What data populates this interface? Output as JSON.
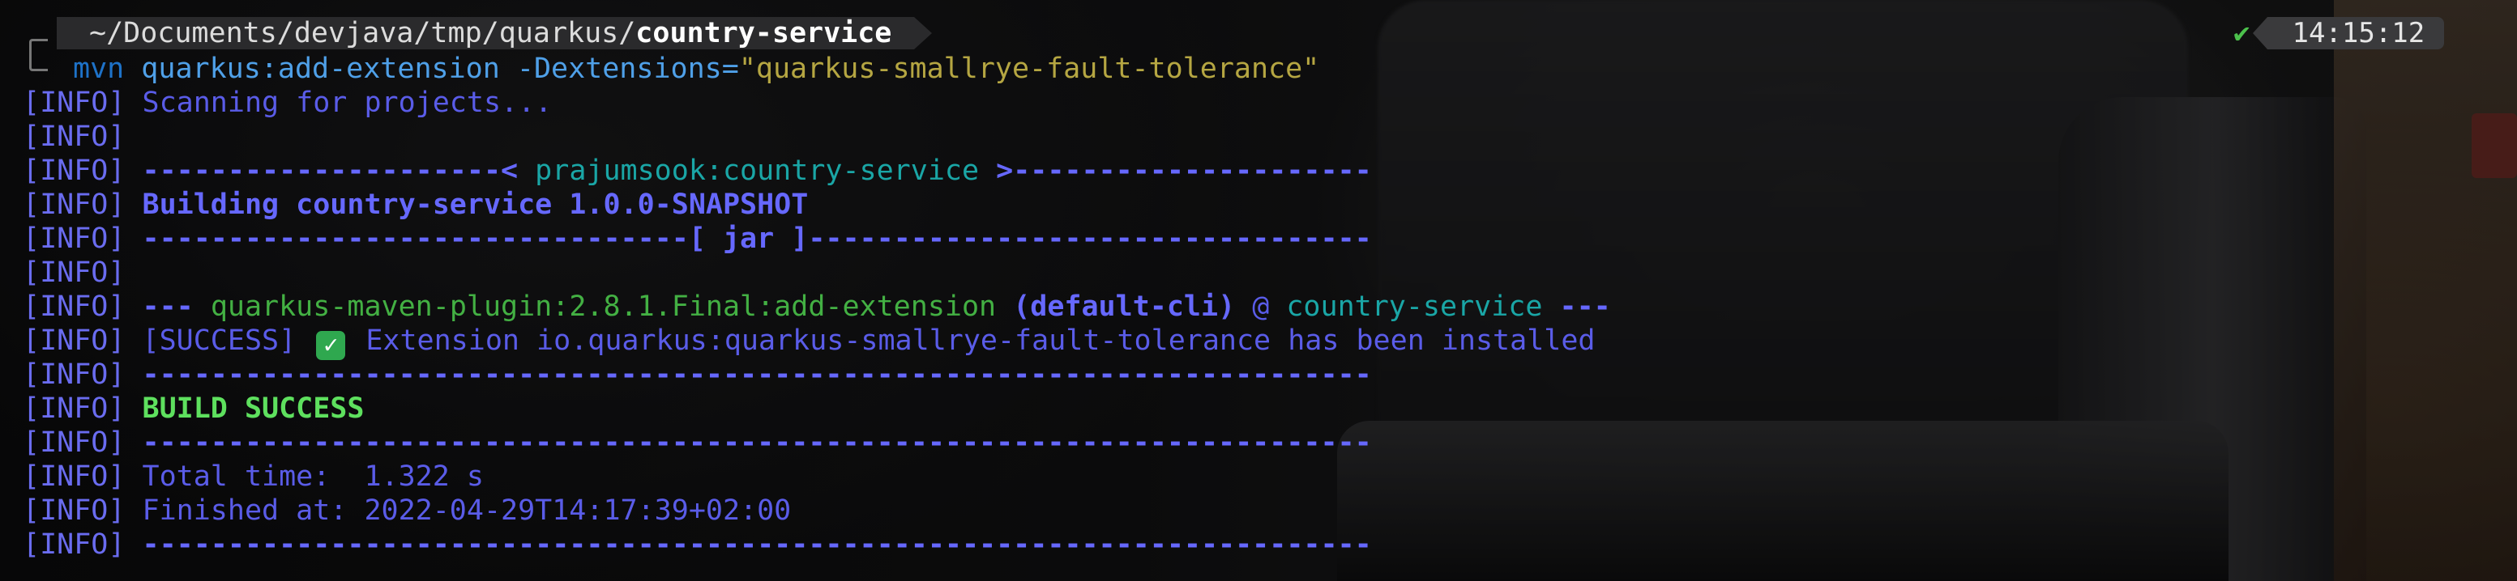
{
  "prompt": {
    "path_prefix": "~/Documents/devjava/tmp/quarkus/",
    "path_current": "country-service",
    "status_icon": "✔",
    "time": "14:15:12"
  },
  "command": {
    "program": "mvn",
    "args": "quarkus:add-extension -Dextensions=",
    "string_arg": "\"quarkus-smallrye-fault-tolerance\""
  },
  "output": {
    "tag": "[INFO]",
    "scanning": "Scanning for projects...",
    "artifact_rule_left": "---------------------< ",
    "artifact_id": "prajumsook:country-service",
    "artifact_rule_right": " >---------------------",
    "building": "Building country-service 1.0.0-SNAPSHOT",
    "jar_rule_left": "--------------------------------[ ",
    "jar_label": "jar",
    "jar_rule_right": " ]---------------------------------",
    "plugin_prefix": "--- ",
    "plugin": "quarkus-maven-plugin:2.8.1.Final:add-extension",
    "execution": "(default-cli)",
    "at": " @ ",
    "module": "country-service",
    "plugin_suffix": " ---",
    "success_tag": "[SUCCESS]",
    "success_emoji": "✓",
    "success_msg": " Extension io.quarkus:quarkus-smallrye-fault-tolerance has been installed",
    "separator": "------------------------------------------------------------------------",
    "build_success": "BUILD SUCCESS",
    "total_time": "Total time:  1.322 s",
    "finished_at": "Finished at: 2022-04-29T14:17:39+02:00"
  },
  "colors": {
    "info": "#6a6cf0",
    "command": "#4fa0e8",
    "string": "#b5a642",
    "success": "#5ee05e",
    "artifact": "#1aa6a6"
  }
}
